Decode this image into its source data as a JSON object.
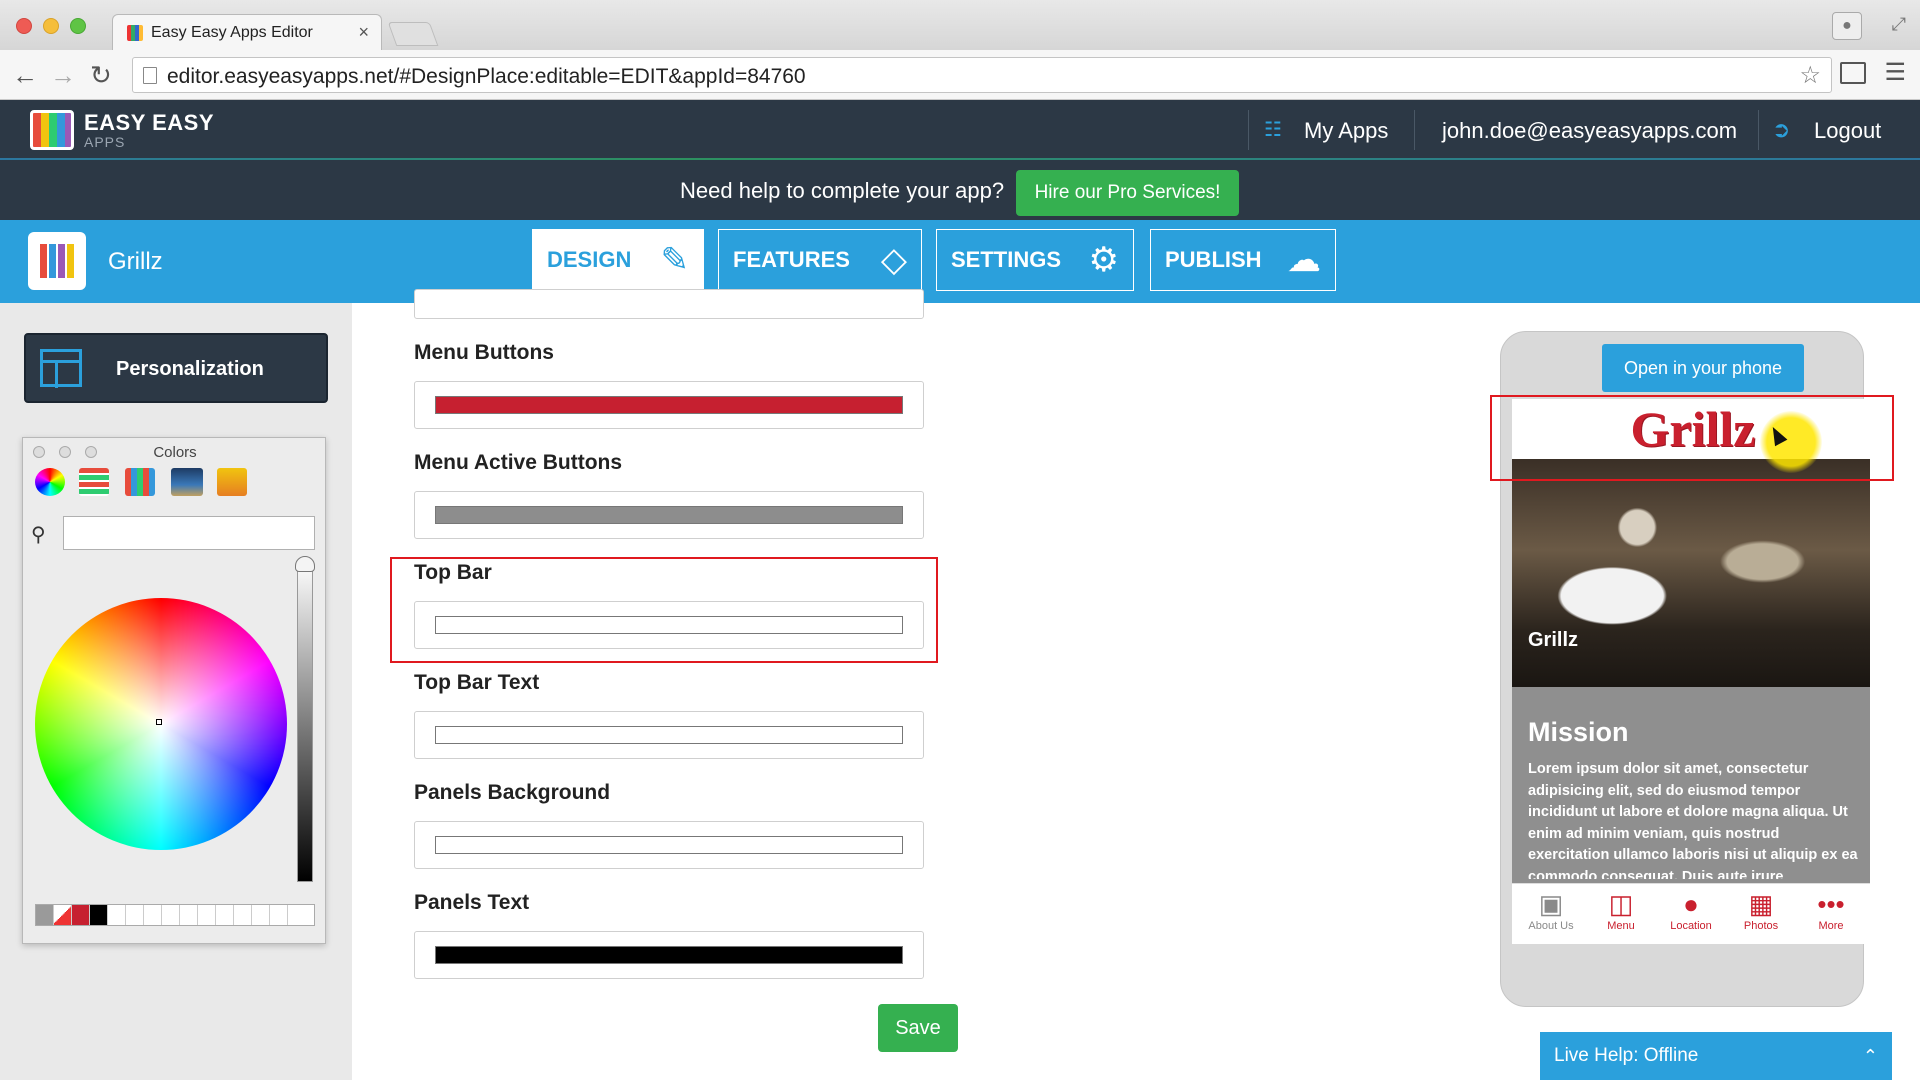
{
  "browser": {
    "tab_title": "Easy Easy Apps Editor",
    "tab_close": "×",
    "url": "editor.easyeasyapps.net/#DesignPlace:editable=EDIT&appId=84760"
  },
  "header": {
    "logo_main": "EASY EASY",
    "logo_sub": "APPS",
    "my_apps": "My Apps",
    "user_email": "john.doe@easyeasyapps.com",
    "logout": "Logout"
  },
  "help_banner": {
    "text": "Need help to complete your app?",
    "button": "Hire our Pro Services!"
  },
  "nav": {
    "app_name": "Grillz",
    "tabs": [
      {
        "label": "DESIGN",
        "icon": "brush-icon",
        "active": true
      },
      {
        "label": "FEATURES",
        "icon": "tag-icon",
        "active": false
      },
      {
        "label": "SETTINGS",
        "icon": "gear-icon",
        "active": false
      },
      {
        "label": "PUBLISH",
        "icon": "cloud-upload-icon",
        "active": false
      }
    ]
  },
  "sidebar": {
    "personalization": "Personalization",
    "colors_panel": {
      "title": "Colors",
      "search_value": ""
    }
  },
  "form": {
    "fields": [
      {
        "label": "Menu Buttons",
        "color": "#c62030"
      },
      {
        "label": "Menu Active Buttons",
        "color": "#8d8d8d"
      },
      {
        "label": "Top Bar",
        "color": "#ffffff"
      },
      {
        "label": "Top Bar Text",
        "color": "#ffffff"
      },
      {
        "label": "Panels Background",
        "color": "#ffffff"
      },
      {
        "label": "Panels Text",
        "color": "#000000"
      }
    ],
    "save": "Save"
  },
  "preview": {
    "open_in_phone": "Open in your phone",
    "brand": "Grillz",
    "hero_label": "Grillz",
    "mission_title": "Mission",
    "mission_body": "Lorem ipsum dolor sit amet, consectetur adipisicing elit, sed do eiusmod tempor incididunt ut labore et dolore magna aliqua. Ut enim ad minim veniam, quis nostrud exercitation ullamco laboris nisi ut aliquip ex ea commodo consequat. Duis aute irure",
    "tabs": [
      {
        "label": "About Us",
        "icon": "open-sign-icon"
      },
      {
        "label": "Menu",
        "icon": "book-icon"
      },
      {
        "label": "Location",
        "icon": "map-pin-icon"
      },
      {
        "label": "Photos",
        "icon": "photos-icon"
      },
      {
        "label": "More",
        "icon": "more-dots-icon"
      }
    ]
  },
  "live_help": "Live Help: Offline",
  "colors": {
    "accent": "#2ba0dc",
    "header_dark": "#2c3845",
    "green": "#35b050",
    "brand_red": "#c9202e"
  }
}
